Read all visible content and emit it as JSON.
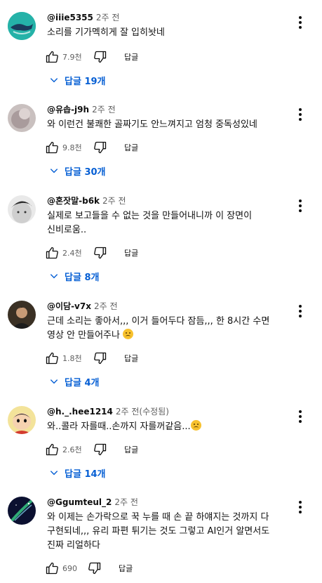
{
  "comments": [
    {
      "author": "@iiie5355",
      "time": "2주 전",
      "text": "소리를 기가멕히게 잘 입히놧네",
      "likes": "7.9천",
      "reply_label": "답글",
      "replies_label": "답글 19개"
    },
    {
      "author": "@유솝-j9h",
      "time": "2주 전",
      "text": "와 이런건 불쾌한 골짜기도 안느껴지고 엄청 중독성있네",
      "likes": "9.8천",
      "reply_label": "답글",
      "replies_label": "답글 30개"
    },
    {
      "author": "@혼잣말-b6k",
      "time": "2주 전",
      "text": "실제로 보고들을 수 없는 것을 만들어내니까 이 장면이 신비로움..",
      "likes": "2.4천",
      "reply_label": "답글",
      "replies_label": "답글 8개"
    },
    {
      "author": "@이담-v7x",
      "time": "2주 전",
      "text": "근데 소리는 좋아서,,, 이거 들어두다 잠듬,,, 한 8시간 수면 영상 안 만들어주나 ",
      "likes": "1.8천",
      "reply_label": "답글",
      "replies_label": "답글 4개"
    },
    {
      "author": "@h._.hee1214",
      "time": "2주 전(수정됨)",
      "text": "와..콜라 자를때..손까지 자를꺼같음...",
      "likes": "2.6천",
      "reply_label": "답글",
      "replies_label": "답글 14개"
    },
    {
      "author": "@Ggumteul_2",
      "time": "2주 전",
      "text": "와 이제는 손가락으로 꾹 누를 때 손 끝 하얘지는 것까지 다 구현되네,,, 유리 파편 튀기는 것도 그렇고 AI인거 알면서도 진짜 리얼하다",
      "likes": "690",
      "reply_label": "답글"
    }
  ],
  "icons": {
    "like": "thumbs-up-icon",
    "dislike": "thumbs-down-icon",
    "more": "more-vert-icon",
    "expand": "chevron-down-icon",
    "emoji": "crying-face-emoji"
  },
  "colors": {
    "link": "#065fd4",
    "secondary": "#606060",
    "text": "#0f0f0f"
  }
}
